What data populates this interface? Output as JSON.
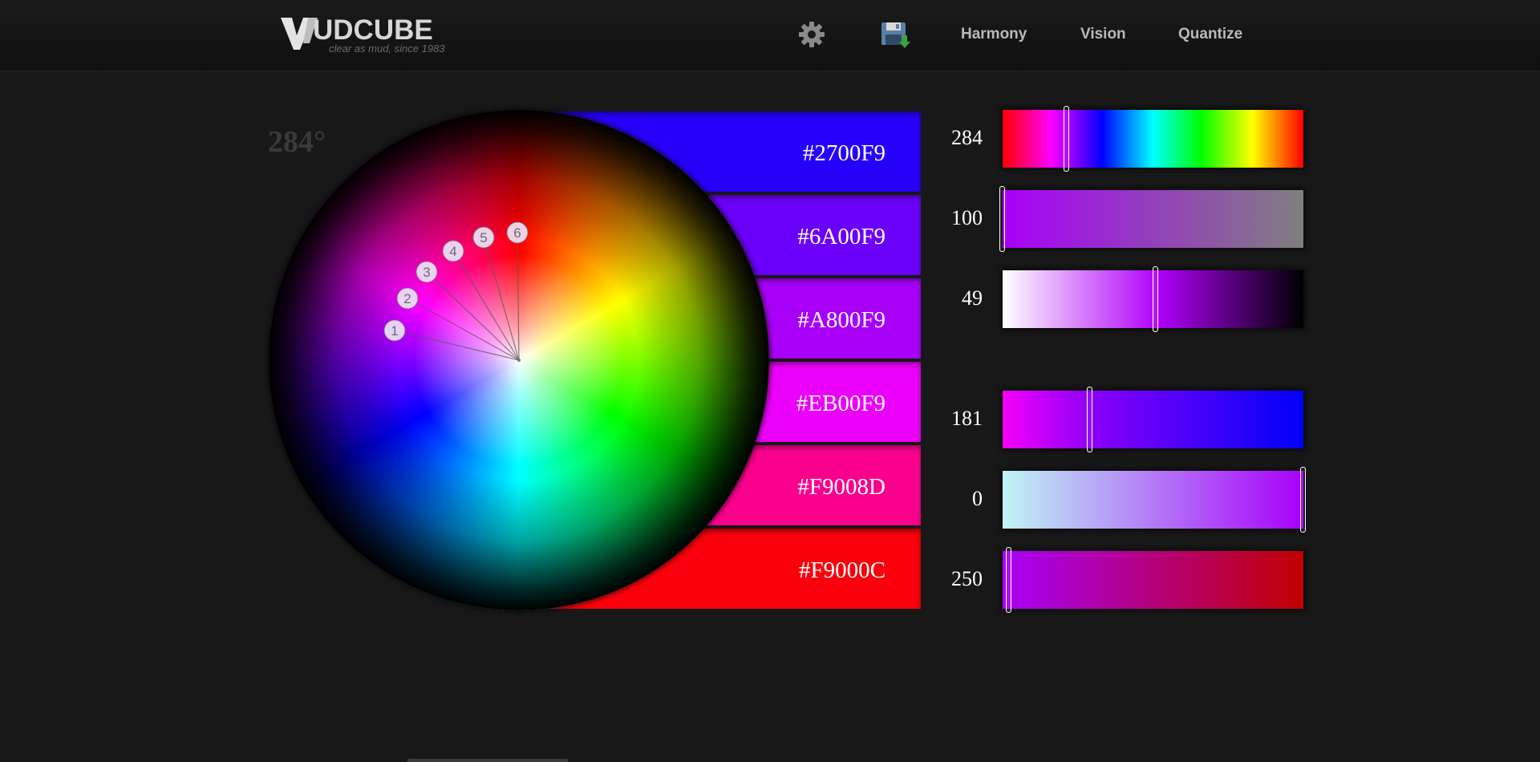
{
  "header": {
    "logo": {
      "mark": "UDCUBE",
      "tagline": "clear as mud, since 1983"
    },
    "icons": [
      "gear-icon",
      "save-icon"
    ],
    "nav": [
      {
        "label": "Harmony"
      },
      {
        "label": "Vision"
      },
      {
        "label": "Quantize"
      }
    ]
  },
  "angle": "284°",
  "wheel": {
    "points": [
      "1",
      "2",
      "3",
      "4",
      "5",
      "6"
    ]
  },
  "swatches": [
    {
      "hex": "#2700F9",
      "color": "#2700F9"
    },
    {
      "hex": "#6A00F9",
      "color": "#6A00F9"
    },
    {
      "hex": "#A800F9",
      "color": "#A800F9"
    },
    {
      "hex": "#EB00F9",
      "color": "#EB00F9"
    },
    {
      "hex": "#F9008D",
      "color": "#F9008D"
    },
    {
      "hex": "#F9000C",
      "color": "#F9000C"
    }
  ],
  "sliders": [
    {
      "value": "284",
      "fraction": 0.214
    },
    {
      "value": "100",
      "fraction": 0.0
    },
    {
      "value": "49",
      "fraction": 0.51
    },
    {
      "value": "181",
      "fraction": 0.29
    },
    {
      "value": "0",
      "fraction": 1.0
    },
    {
      "value": "250",
      "fraction": 0.02
    }
  ]
}
